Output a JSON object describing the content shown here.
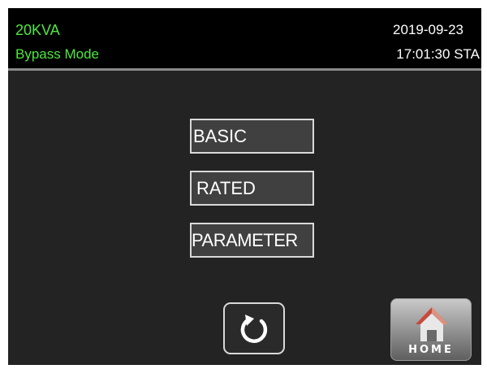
{
  "header": {
    "model": "20KVA",
    "mode": "Bypass Mode",
    "date": "2019-09-23",
    "time": "17:01:30 STA"
  },
  "menu": {
    "items": [
      {
        "label": "BASIC"
      },
      {
        "label": "RATED"
      },
      {
        "label": "PARAMETER"
      }
    ]
  },
  "footer": {
    "back_icon": "rotate-back-icon",
    "home_label": "HOME",
    "home_icon": "house-icon"
  },
  "colors": {
    "status_text": "#4ee83d",
    "background": "#232323",
    "header_background": "#000000",
    "button_fill": "#404040",
    "button_border": "#d9d9d9",
    "home_roof": "#c84a3a"
  }
}
